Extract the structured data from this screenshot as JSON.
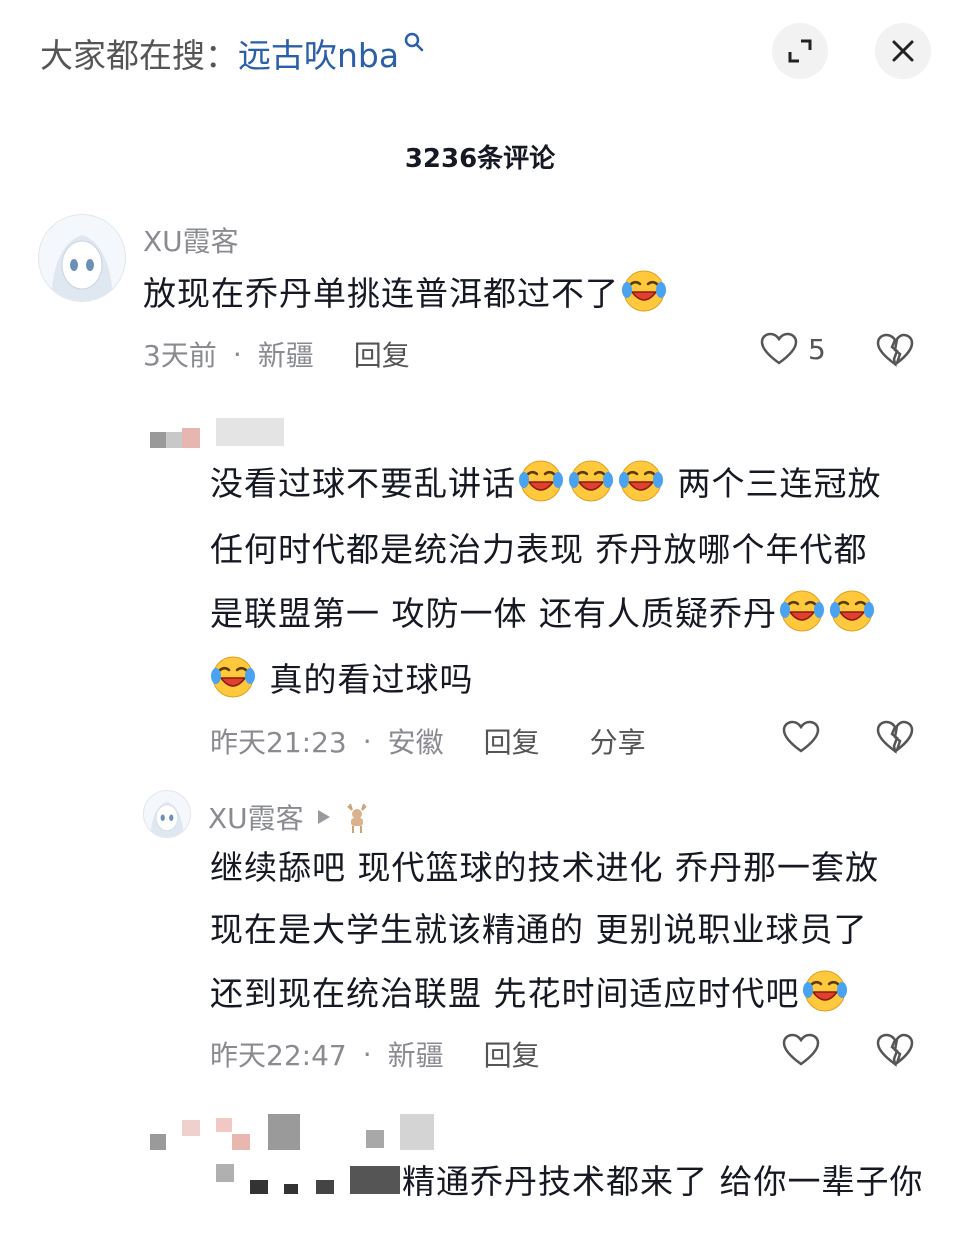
{
  "header": {
    "search_prefix": "大家都在搜：",
    "search_term": "远古吹nba",
    "icons": {
      "search": "search-icon",
      "expand": "expand-icon",
      "close": "close-icon"
    }
  },
  "comment_count": "3236条评论",
  "comments": [
    {
      "username": "XU霞客",
      "text": "放现在乔丹单挑连普洱都过不了",
      "time": "3天前",
      "location": "新疆",
      "reply_label": "回复",
      "likes": "5"
    },
    {
      "username": "",
      "text_1": "没看过球不要乱讲话",
      "text_1b": "两个三连冠放",
      "text_2": "任何时代都是统治力表现 乔丹放哪个年代都",
      "text_3": "是联盟第一 攻防一体 还有人质疑乔丹",
      "text_4": "真的看过球吗",
      "time": "昨天21:23",
      "location": "安徽",
      "reply_label": "回复",
      "share_label": "分享"
    },
    {
      "username": "XU霞客",
      "text_1": "继续舔吧 现代篮球的技术进化 乔丹那一套放",
      "text_2": "现在是大学生就该精通的 更别说职业球员了",
      "text_3": "还到现在统治联盟 先花时间适应时代吧",
      "time": "昨天22:47",
      "location": "新疆",
      "reply_label": "回复"
    },
    {
      "username": "",
      "text_1": "精通乔丹技术都来了 给你一辈子你"
    }
  ],
  "colors": {
    "accent_link": "#2b5fa8",
    "meta_gray": "#8a8b91",
    "text": "#161823"
  }
}
